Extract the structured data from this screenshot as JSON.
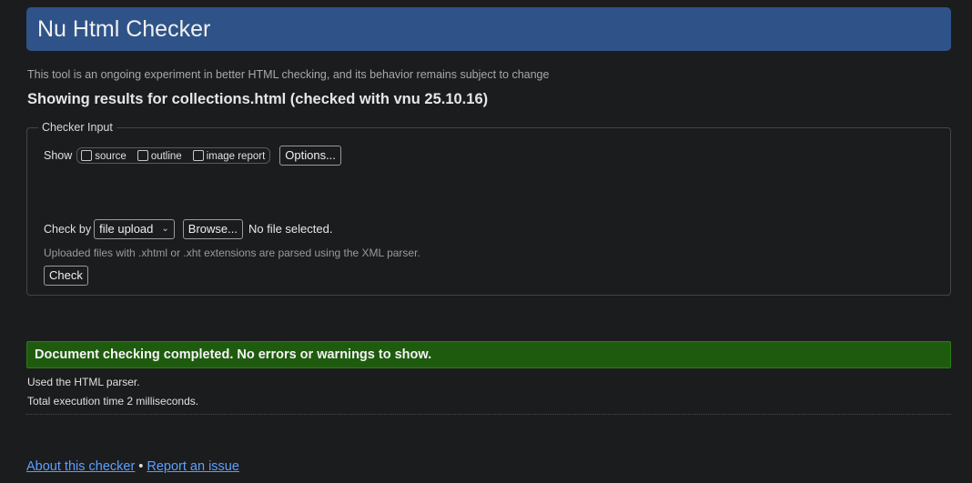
{
  "header": {
    "title": "Nu Html Checker"
  },
  "notice": "This tool is an ongoing experiment in better HTML checking, and its behavior remains subject to change",
  "results_title": "Showing results for collections.html (checked with vnu 25.10.16)",
  "checker_input": {
    "legend": "Checker Input",
    "show_label": "Show",
    "show_options": [
      {
        "label": "source",
        "checked": false
      },
      {
        "label": "outline",
        "checked": false
      },
      {
        "label": "image report",
        "checked": false
      }
    ],
    "options_button": "Options...",
    "check_by_label": "Check by",
    "check_by_value": "file upload",
    "browse_button": "Browse...",
    "file_status": "No file selected.",
    "xml_note": "Uploaded files with .xhtml or .xht extensions are parsed using the XML parser.",
    "check_button": "Check"
  },
  "result": {
    "message": "Document checking completed. No errors or warnings to show.",
    "status_color": "#1e5b0e",
    "parser": "Used the HTML parser.",
    "execution_time": "Total execution time 2 milliseconds."
  },
  "footer": {
    "about_link": "About this checker",
    "separator": "•",
    "report_link": "Report an issue"
  },
  "colors": {
    "header_bg": "#2f5388",
    "page_bg": "#1b1c1e",
    "link": "#5aa0ff"
  }
}
